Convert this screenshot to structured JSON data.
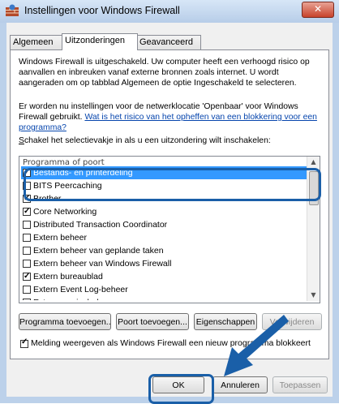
{
  "window": {
    "title": "Instellingen voor Windows Firewall",
    "close_label": "✕"
  },
  "tabs": [
    {
      "label": "Algemeen",
      "active": false
    },
    {
      "label": "Uitzonderingen",
      "active": true
    },
    {
      "label": "Geavanceerd",
      "active": false
    }
  ],
  "info": {
    "para1": "Windows Firewall is uitgeschakeld. Uw computer heeft een verhoogd risico op aanvallen en inbreuken vanaf externe bronnen zoals internet. U wordt aangeraden om op tabblad Algemeen de optie Ingeschakeld te selecteren.",
    "para2_text": "Er worden nu instellingen voor de netwerklocatie 'Openbaar' voor Windows Firewall gebruikt.",
    "para2_link": "Wat is het risico van het opheffen van een blokkering voor een programma?",
    "instruction_first": "S",
    "instruction_rest": "chakel het selectievakje in als u een uitzondering wilt inschakelen:"
  },
  "list": {
    "header": "Programma of poort",
    "items": [
      {
        "label": "Bestands- en printerdeling",
        "checked": true,
        "selected": true
      },
      {
        "label": "BITS Peercaching",
        "checked": false,
        "selected": false
      },
      {
        "label": "Brother",
        "checked": true,
        "selected": false
      },
      {
        "label": "Core Networking",
        "checked": true,
        "selected": false
      },
      {
        "label": "Distributed Transaction Coordinator",
        "checked": false,
        "selected": false
      },
      {
        "label": "Extern beheer",
        "checked": false,
        "selected": false
      },
      {
        "label": "Extern beheer van geplande taken",
        "checked": false,
        "selected": false
      },
      {
        "label": "Extern beheer van Windows Firewall",
        "checked": false,
        "selected": false
      },
      {
        "label": "Extern bureaublad",
        "checked": true,
        "selected": false
      },
      {
        "label": "Extern Event Log-beheer",
        "checked": false,
        "selected": false
      },
      {
        "label": "Extern servicebeheer",
        "checked": false,
        "selected": false
      }
    ]
  },
  "buttons": {
    "add_program": "Programma toevoegen...",
    "add_port": "Poort toevoegen...",
    "properties": "Eigenschappen",
    "delete": "Verwijderen"
  },
  "notify": {
    "label": "Melding weergeven als Windows Firewall een nieuw programma blokkeert",
    "checked": true
  },
  "footer": {
    "ok": "OK",
    "cancel": "Annuleren",
    "apply": "Toepassen"
  },
  "colors": {
    "accent": "#1a5fa8",
    "selection": "#3399ff",
    "link": "#0645ad"
  }
}
